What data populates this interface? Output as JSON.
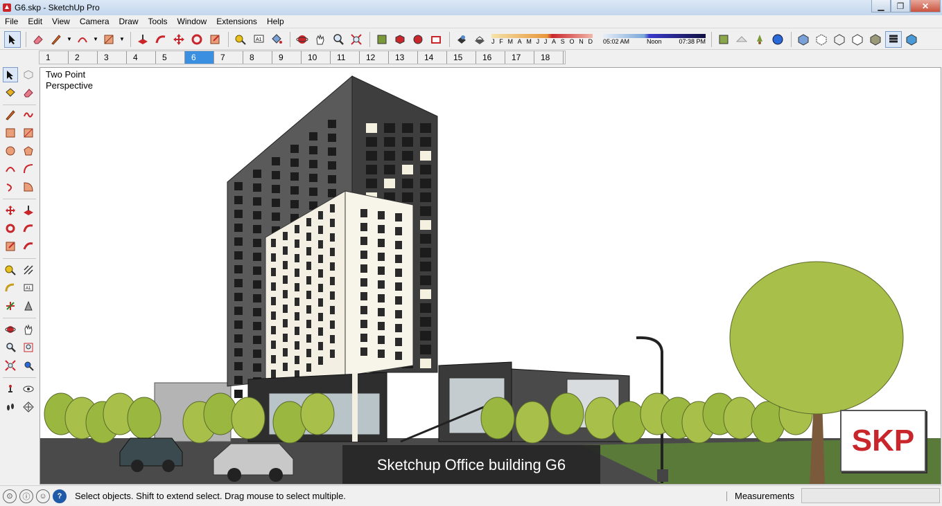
{
  "window": {
    "title": "G6.skp - SketchUp Pro"
  },
  "menu": [
    "File",
    "Edit",
    "View",
    "Camera",
    "Draw",
    "Tools",
    "Window",
    "Extensions",
    "Help"
  ],
  "shadows": {
    "months": [
      "J",
      "F",
      "M",
      "A",
      "M",
      "J",
      "J",
      "A",
      "S",
      "O",
      "N",
      "D"
    ],
    "time_start": "05:02 AM",
    "time_mid": "Noon",
    "time_end": "07:38 PM"
  },
  "scene_tabs": [
    "1",
    "2",
    "3",
    "4",
    "5",
    "6",
    "7",
    "8",
    "9",
    "10",
    "11",
    "12",
    "13",
    "14",
    "15",
    "16",
    "17",
    "18"
  ],
  "active_scene": "6",
  "viewport": {
    "camera_label": "Two Point\nPerspective",
    "caption": "Sketchup Office building G6",
    "logo": "SKP"
  },
  "status": {
    "message": "Select objects. Shift to extend select. Drag mouse to select multiple.",
    "measurements_label": "Measurements",
    "measurements_value": ""
  },
  "colors": {
    "accent": "#3b8fe0",
    "logo_red": "#c8262b",
    "caption_bg": "#262626",
    "tree": "#a8c04a"
  }
}
